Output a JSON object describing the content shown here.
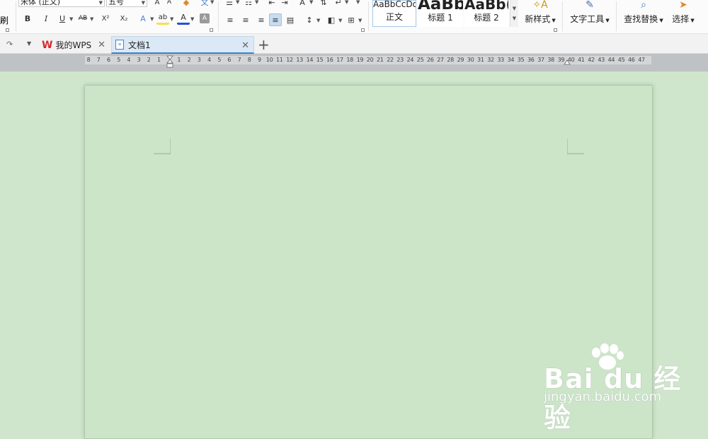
{
  "ribbon": {
    "format_painter_label": "刷",
    "font_name": "宋体 (正文)",
    "font_size": "五号",
    "bold": "B",
    "italic": "I",
    "underline": "U",
    "strike": "AB",
    "superscript": "X²",
    "subscript": "X₂",
    "text_effect": "A",
    "highlight": "ab",
    "font_color": "A",
    "char_shading": "A",
    "styles": [
      {
        "preview": "AaBbCcDd",
        "name": "正文"
      },
      {
        "preview": "AaBb",
        "name": "标题 1"
      },
      {
        "preview": "AaBb(",
        "name": "标题 2"
      }
    ],
    "new_style_label": "新样式",
    "text_tools_label": "文字工具",
    "find_replace_label": "查找替换",
    "select_label": "选择"
  },
  "tabs": {
    "home_label": "我的WPS",
    "doc_label": "文档1",
    "new_tab_symbol": "+"
  },
  "ruler": {
    "labels": [
      "8",
      "7",
      "6",
      "5",
      "4",
      "3",
      "2",
      "1",
      "",
      "1",
      "2",
      "3",
      "4",
      "5",
      "6",
      "7",
      "8",
      "9",
      "10",
      "11",
      "12",
      "13",
      "14",
      "15",
      "16",
      "17",
      "18",
      "19",
      "20",
      "21",
      "22",
      "23",
      "24",
      "25",
      "26",
      "27",
      "28",
      "29",
      "30",
      "31",
      "32",
      "33",
      "34",
      "35",
      "36",
      "37",
      "38",
      "39",
      "40",
      "41",
      "42",
      "43",
      "44",
      "45",
      "46",
      "47"
    ]
  },
  "watermark": {
    "logo": "Bai du 经验",
    "site": "jingyan.baidu.com"
  },
  "colors": {
    "page_background": "#cce5c9",
    "active_tab_underline": "#3c7fd0",
    "wps_red": "#d9262c"
  }
}
